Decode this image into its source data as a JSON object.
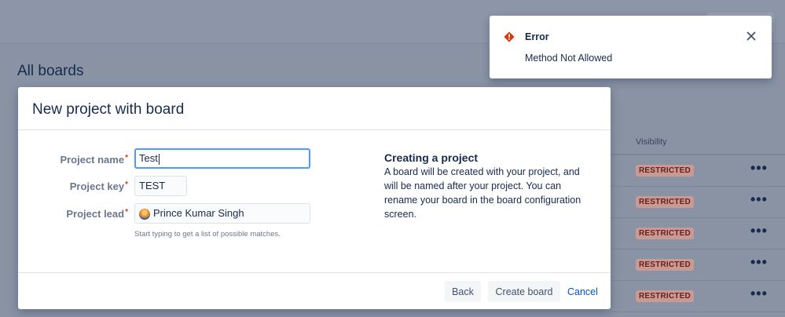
{
  "background": {
    "page_title": "All boards",
    "table": {
      "visibility_header": "Visibility",
      "rows": [
        {
          "badge": "RESTRICTED",
          "more": "•••"
        },
        {
          "badge": "RESTRICTED",
          "more": "•••"
        },
        {
          "badge": "RESTRICTED",
          "more": "•••"
        },
        {
          "badge": "RESTRICTED",
          "more": "•••"
        },
        {
          "badge": "RESTRICTED",
          "more": "•••"
        }
      ]
    }
  },
  "modal": {
    "title": "New project with board",
    "fields": {
      "project_name": {
        "label": "Project name",
        "value": "Test"
      },
      "project_key": {
        "label": "Project key",
        "value": "TEST"
      },
      "project_lead": {
        "label": "Project lead",
        "value": "Prince Kumar Singh"
      }
    },
    "required_marker": "*",
    "help_text": "Start typing to get a list of possible matches.",
    "info": {
      "title": "Creating a project",
      "text": "A board will be created with your project, and will be named after your project. You can rename your board in the board configuration screen."
    },
    "footer": {
      "back_label": "Back",
      "create_label": "Create board",
      "cancel_label": "Cancel"
    }
  },
  "flag": {
    "title": "Error",
    "message": "Method Not Allowed",
    "icon": "error-icon",
    "close_icon": "close-icon"
  },
  "colors": {
    "error_red": "#de350b",
    "focus_blue": "#4c9aff",
    "link_blue": "#0052cc",
    "overlay": "#8993a4"
  }
}
